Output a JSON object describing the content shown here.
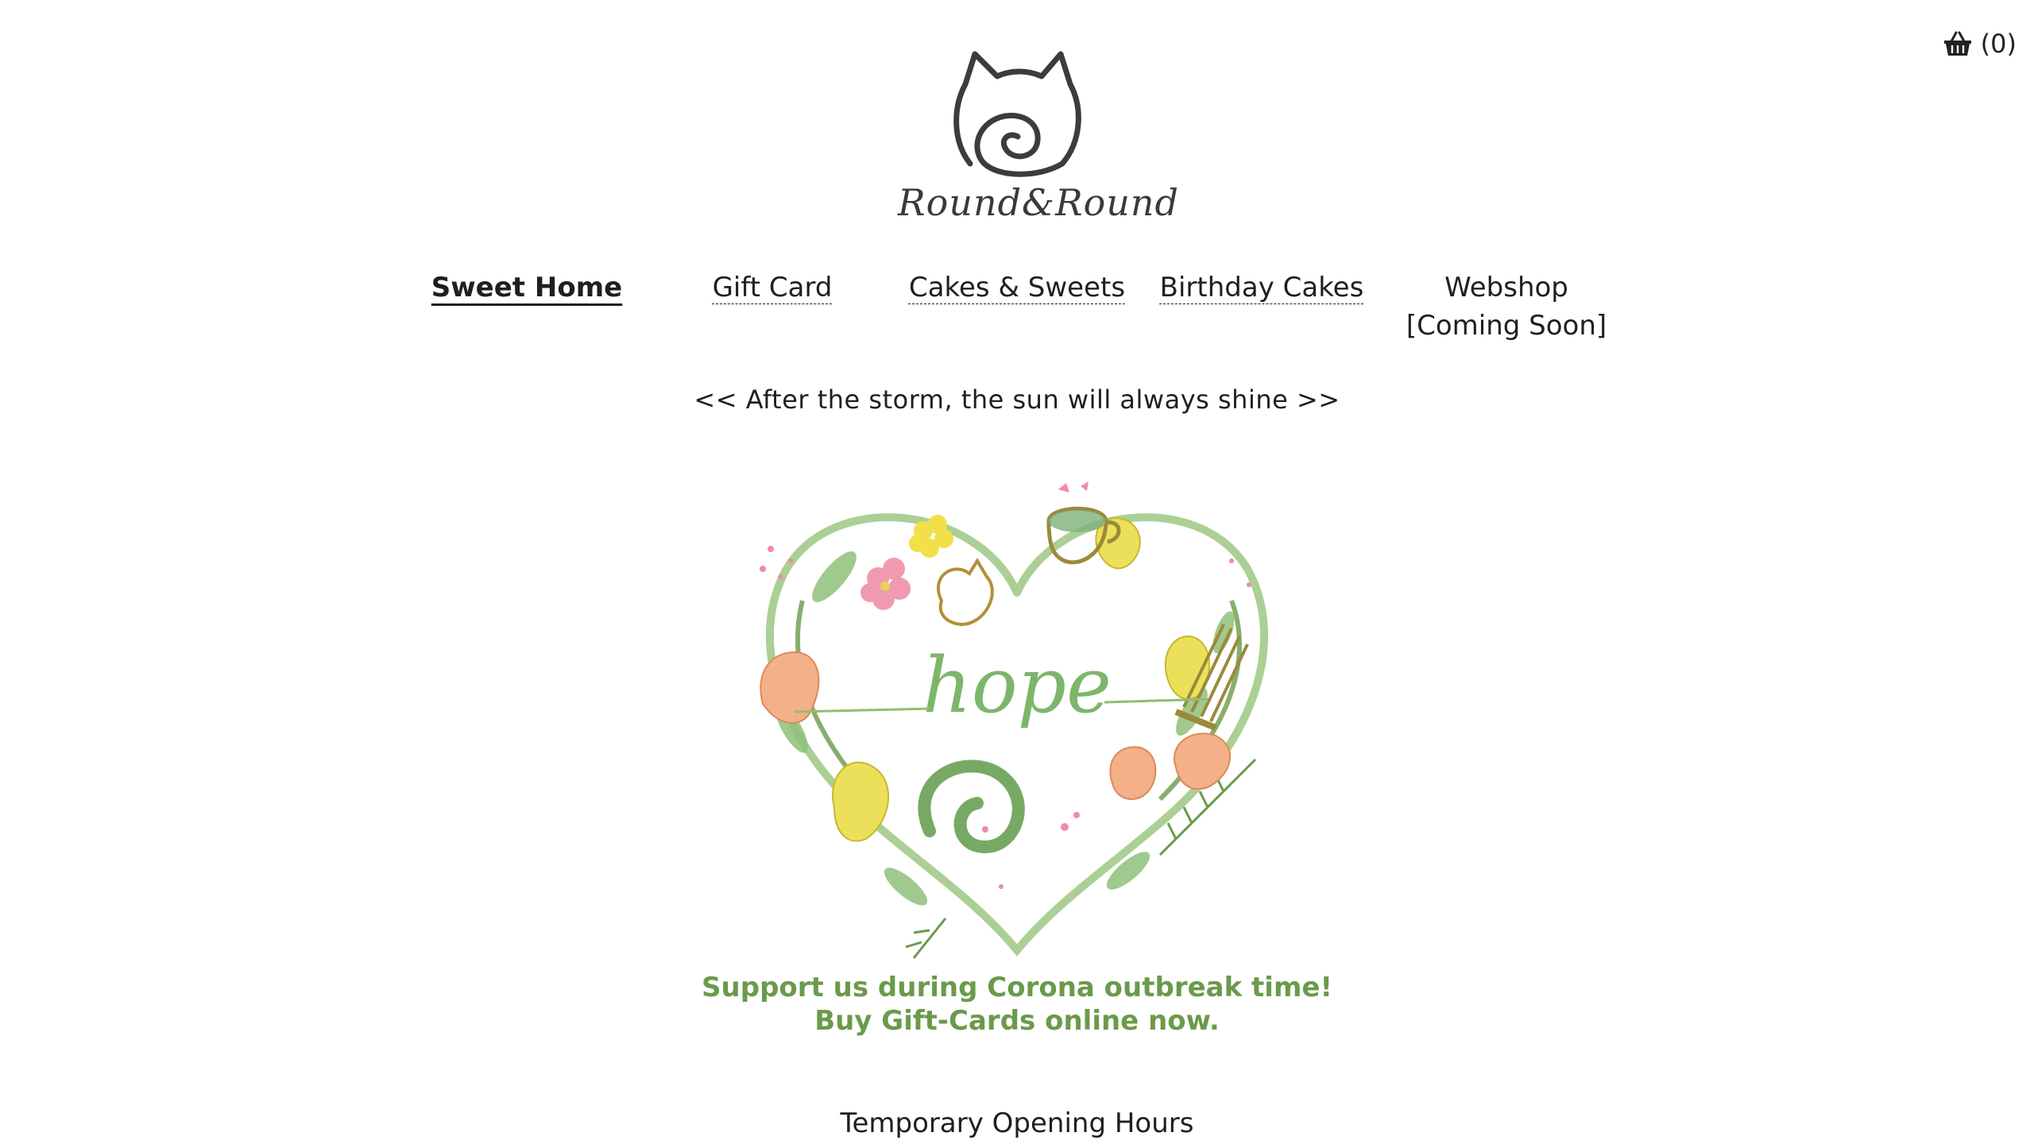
{
  "cart": {
    "icon": "basket-icon",
    "count_label": "(0)"
  },
  "logo": {
    "icon": "cat-logo-icon",
    "wordmark": "Round&Round"
  },
  "nav": {
    "items": [
      {
        "label": "Sweet Home",
        "active": true
      },
      {
        "label": "Gift Card"
      },
      {
        "label": "Cakes & Sweets"
      },
      {
        "label": "Birthday Cakes"
      },
      {
        "label_line1": "Webshop",
        "label_line2": "[Coming Soon]"
      }
    ]
  },
  "tagline": "<< After the storm, the sun will always shine >>",
  "hero": {
    "image": "hope-floral-heart-illustration",
    "hope_text": "hope",
    "support_line1": "Support us during Corona outbreak time!",
    "support_line2": "Buy Gift-Cards online now.",
    "colors": {
      "leaf_green": "#6a9a4a",
      "tulip_orange": "#f0a878",
      "tulip_yellow": "#e8e060",
      "blossom_pink": "#f08aa8",
      "matcha_brown": "#9a8a3a"
    }
  },
  "hours_heading": "Temporary Opening Hours"
}
